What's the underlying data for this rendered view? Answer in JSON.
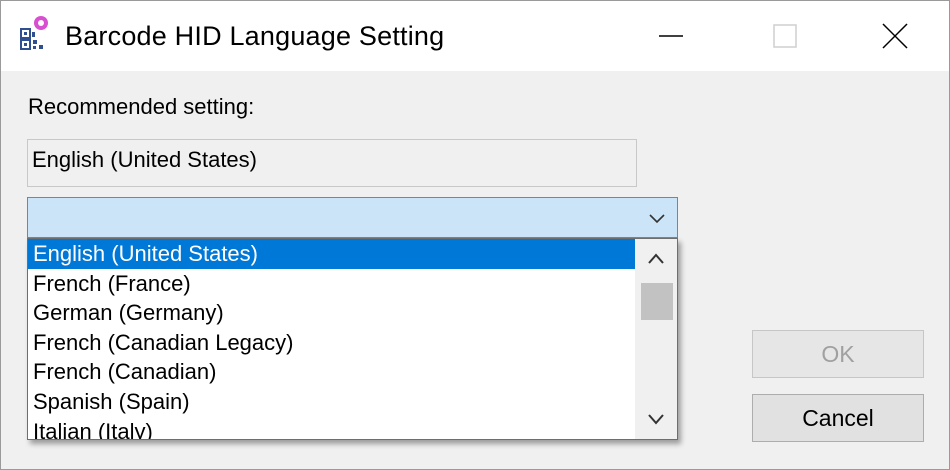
{
  "window": {
    "title": "Barcode HID Language Setting",
    "icons": {
      "app": "barcode-app-icon",
      "minimize": "minimize-icon",
      "maximize": "maximize-icon",
      "close": "close-icon"
    }
  },
  "recommended": {
    "label": "Recommended setting:",
    "value": "English (United States)"
  },
  "combo": {
    "value": "",
    "arrow_icon": "chevron-down-icon"
  },
  "dropdown": {
    "selected_index": 0,
    "items": [
      "English (United States)",
      "French (France)",
      "German (Germany)",
      "French (Canadian Legacy)",
      "French (Canadian)",
      "Spanish (Spain)",
      "Italian (Italy)"
    ],
    "scroll_icons": {
      "up": "chevron-up-icon",
      "down": "chevron-down-icon"
    }
  },
  "buttons": {
    "ok": "OK",
    "cancel": "Cancel"
  },
  "colors": {
    "selection": "#0078d7",
    "combo_focus": "#cce4f7",
    "combo_border": "#4a90d9",
    "app_icon_accent": "#d94fd1"
  }
}
